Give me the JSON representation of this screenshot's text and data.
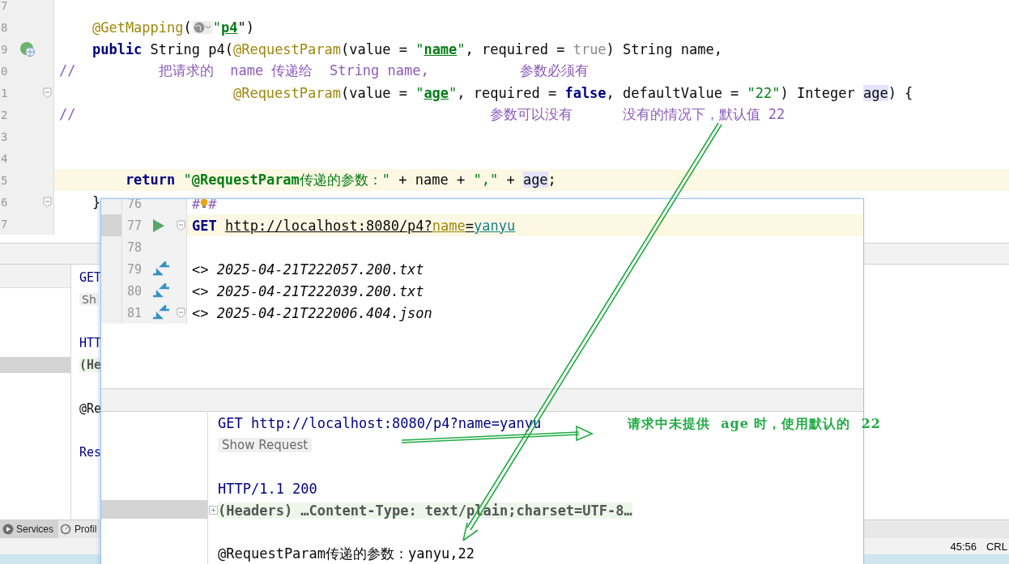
{
  "editor": {
    "lines": [
      {
        "number": "7",
        "kind": "code",
        "highlighted": false
      },
      {
        "number": "8",
        "kind": "code",
        "highlighted": false,
        "segments": [
          {
            "text": "    @GetMapping",
            "kind": "annotation"
          },
          {
            "text": "(",
            "kind": "plain"
          },
          {
            "kind": "globe"
          },
          {
            "text": "\"",
            "kind": "string"
          },
          {
            "text": "p4",
            "kind": "reference"
          },
          {
            "text": "\")",
            "kind": "plain"
          }
        ]
      },
      {
        "number": "9",
        "kind": "endpoint",
        "highlighted": false,
        "segments": [
          {
            "text": "    public",
            "kind": "keyword"
          },
          {
            "text": " String p4(",
            "kind": "plain"
          },
          {
            "text": "@RequestParam",
            "kind": "annotation"
          },
          {
            "text": "(value = ",
            "kind": "plain"
          },
          {
            "text": "\"",
            "kind": "string"
          },
          {
            "text": "name",
            "kind": "reference"
          },
          {
            "text": "\"",
            "kind": "string"
          },
          {
            "text": ", required = ",
            "kind": "plain"
          },
          {
            "text": "true",
            "kind": "literal"
          },
          {
            "text": ") String name,",
            "kind": "plain"
          }
        ]
      },
      {
        "number": "0",
        "kind": "code",
        "highlighted": false,
        "segments": [
          {
            "text": "//          把请求的  name 传递给  String name,           参数必须有",
            "kind": "comment"
          }
        ]
      },
      {
        "number": "1",
        "kind": "code",
        "highlighted": false,
        "fold": true,
        "segments": [
          {
            "text": "                     @RequestParam",
            "kind": "annotation"
          },
          {
            "text": "(value = ",
            "kind": "plain"
          },
          {
            "text": "\"",
            "kind": "string"
          },
          {
            "text": "age",
            "kind": "reference"
          },
          {
            "text": "\"",
            "kind": "string"
          },
          {
            "text": ", required = ",
            "kind": "plain"
          },
          {
            "text": "false",
            "kind": "keyword"
          },
          {
            "text": ", defaultValue = ",
            "kind": "plain"
          },
          {
            "text": "\"22\"",
            "kind": "string"
          },
          {
            "text": ") Integer ",
            "kind": "plain"
          },
          {
            "text": "age",
            "kind": "usage"
          },
          {
            "text": ") {",
            "kind": "plain"
          }
        ]
      },
      {
        "number": "2",
        "kind": "code",
        "highlighted": false,
        "segments": [
          {
            "text": "//                                                  参数可以没有      没有的情况下，默认值 22",
            "kind": "comment"
          }
        ]
      },
      {
        "number": "3",
        "kind": "code",
        "highlighted": false
      },
      {
        "number": "4",
        "kind": "code",
        "highlighted": false
      },
      {
        "number": "5",
        "kind": "code",
        "highlighted": true,
        "segments": [
          {
            "text": "        return",
            "kind": "keyword"
          },
          {
            "text": " \"",
            "kind": "string"
          },
          {
            "text": "@RequestParam",
            "kind": "stringbold"
          },
          {
            "text": "传递的参数：\"",
            "kind": "string"
          },
          {
            "text": " + name + ",
            "kind": "plain"
          },
          {
            "text": "\",\"",
            "kind": "string"
          },
          {
            "text": " + ",
            "kind": "plain"
          },
          {
            "text": "age",
            "kind": "usage"
          },
          {
            "text": ";",
            "kind": "plain"
          }
        ]
      },
      {
        "number": "6",
        "kind": "code",
        "highlighted": false,
        "fold": true,
        "segments": [
          {
            "text": "    }",
            "kind": "plain"
          }
        ]
      },
      {
        "number": "7",
        "kind": "code",
        "highlighted": false
      }
    ]
  },
  "response_panel": {
    "lines": [
      {
        "kind": "request",
        "text": "GET"
      },
      {
        "kind": "button",
        "text": "Sh"
      },
      {
        "kind": "blank"
      },
      {
        "kind": "status",
        "text": "HTT"
      },
      {
        "kind": "headers",
        "text": "(He"
      },
      {
        "kind": "blank"
      },
      {
        "kind": "body",
        "text": "@Re"
      },
      {
        "kind": "blank"
      },
      {
        "kind": "request",
        "text": "Res"
      }
    ]
  },
  "tool_tabs": [
    {
      "label": "Services",
      "selected": true
    },
    {
      "label": "Profil",
      "selected": false
    }
  ],
  "status_bar": {
    "position": "45:56",
    "line_separator": "CRL"
  },
  "popup": {
    "lines": [
      {
        "number": "76",
        "kind": "separator",
        "highlighted": false,
        "segments": [
          {
            "text": "#",
            "kind": "comment"
          },
          {
            "kind": "bulb"
          },
          {
            "text": "#",
            "kind": "comment"
          }
        ]
      },
      {
        "number": "77",
        "kind": "request",
        "highlighted": true,
        "fold": true,
        "segments": [
          {
            "text": "GET ",
            "kind": "keyword"
          },
          {
            "text": "http://localhost:8080/p4?",
            "kind": "url"
          },
          {
            "text": "name",
            "kind": "urlparam"
          },
          {
            "text": "=",
            "kind": "url"
          },
          {
            "text": "yanyu",
            "kind": "urlvalue"
          }
        ]
      },
      {
        "number": "78",
        "kind": "blank",
        "highlighted": false
      },
      {
        "number": "79",
        "kind": "response_file",
        "highlighted": false,
        "segments": [
          {
            "text": "<> ",
            "kind": "plain"
          },
          {
            "text": "2025-04-21T222057.200.txt",
            "kind": "italic"
          }
        ]
      },
      {
        "number": "80",
        "kind": "response_file",
        "highlighted": false,
        "segments": [
          {
            "text": "<> ",
            "kind": "plain"
          },
          {
            "text": "2025-04-21T222039.200.txt",
            "kind": "italic"
          }
        ]
      },
      {
        "number": "81",
        "kind": "response_file",
        "highlighted": false,
        "fold": true,
        "segments": [
          {
            "text": "<> ",
            "kind": "plain"
          },
          {
            "text": "2025-04-21T222006.404.json",
            "kind": "italic"
          }
        ]
      }
    ],
    "response": [
      {
        "kind": "request",
        "text": "GET http://localhost:8080/p4?name=yanyu"
      },
      {
        "kind": "button",
        "text": "Show Request"
      },
      {
        "kind": "blank"
      },
      {
        "kind": "status",
        "text": "HTTP/1.1 200"
      },
      {
        "kind": "headers",
        "text": "(Headers) …Content-Type: text/plain;charset=UTF-8…"
      },
      {
        "kind": "blank"
      },
      {
        "kind": "body",
        "text": "@RequestParam传递的参数：yanyu,22"
      }
    ]
  },
  "annotation": {
    "text": "请求中未提供  age 时，使用默认的  22"
  }
}
